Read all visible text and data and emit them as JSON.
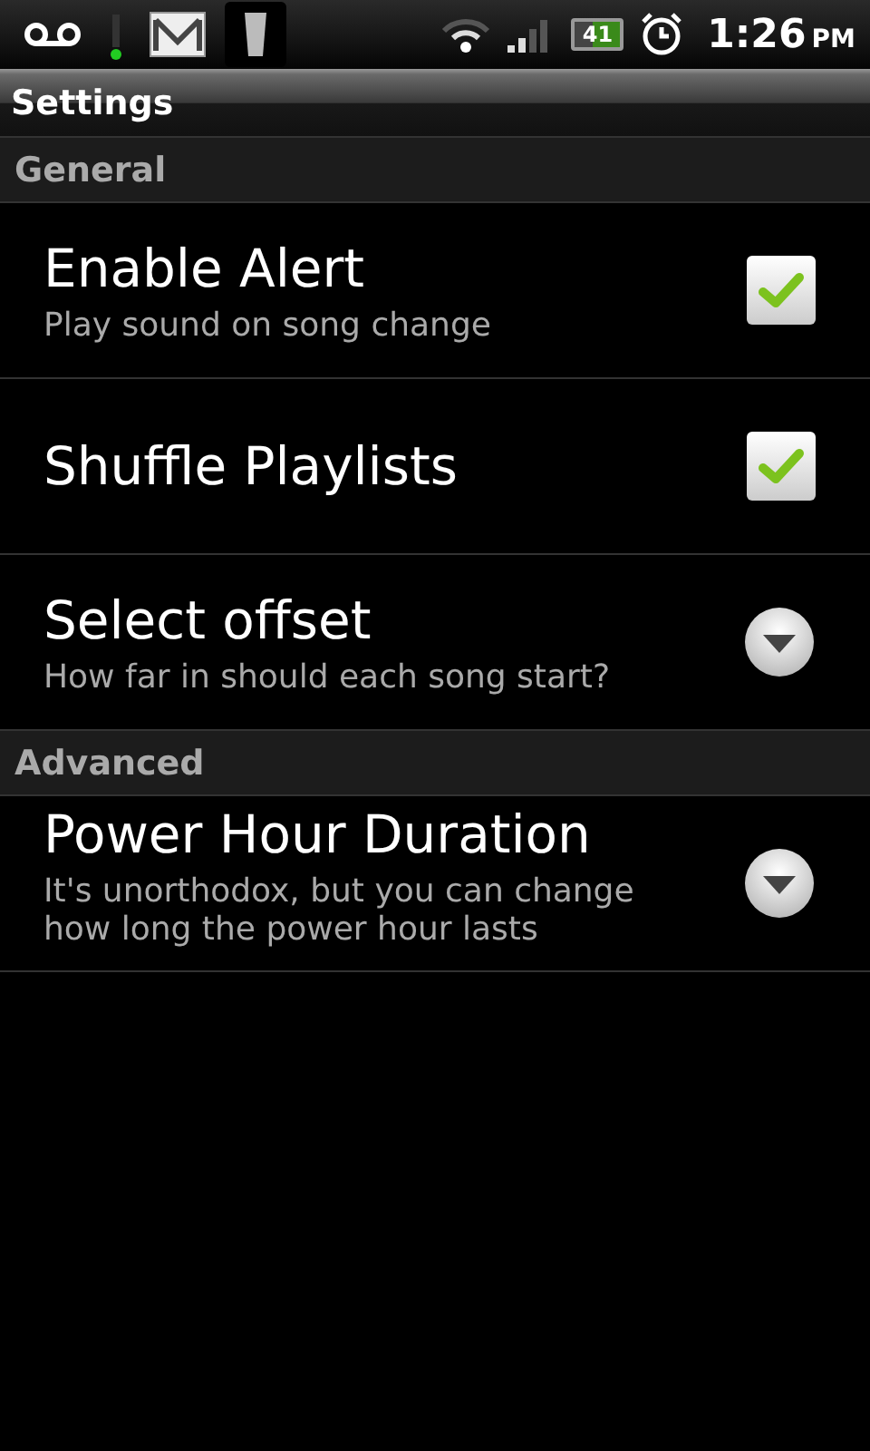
{
  "status_bar": {
    "battery": "41",
    "time": "1:26",
    "ampm": "PM"
  },
  "title_bar": {
    "title": "Settings"
  },
  "sections": [
    {
      "header": "General",
      "items": [
        {
          "kind": "checkbox",
          "title": "Enable Alert",
          "summary": "Play sound on song change",
          "checked": true
        },
        {
          "kind": "checkbox",
          "title": "Shuffle Playlists",
          "checked": true
        },
        {
          "kind": "dropdown",
          "title": "Select offset",
          "summary": "How far in should each song start?"
        }
      ]
    },
    {
      "header": "Advanced",
      "items": [
        {
          "kind": "dropdown",
          "title": "Power Hour Duration",
          "summary": "It's unorthodox, but you can change how long the power hour lasts"
        }
      ]
    }
  ]
}
